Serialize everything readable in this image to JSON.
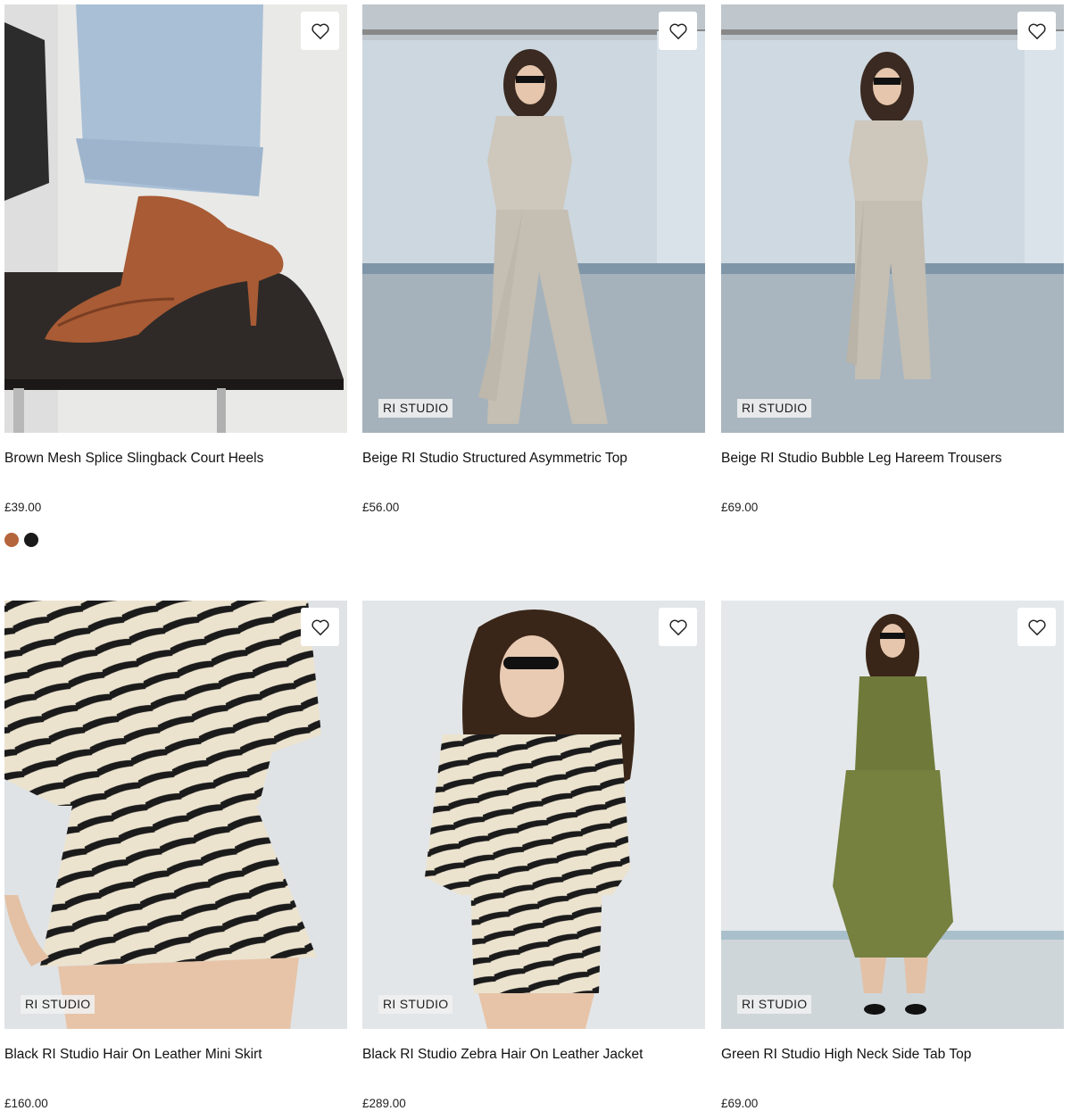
{
  "products": [
    {
      "title": "Brown Mesh Splice Slingback Court Heels",
      "price": "£39.00",
      "badge": "",
      "swatches": [
        "#b5653b",
        "#1a1a1a"
      ]
    },
    {
      "title": "Beige RI Studio Structured Asymmetric Top",
      "price": "£56.00",
      "badge": "RI STUDIO"
    },
    {
      "title": "Beige RI Studio Bubble Leg Hareem Trousers",
      "price": "£69.00",
      "badge": "RI STUDIO"
    },
    {
      "title": "Black RI Studio Hair On Leather Mini Skirt",
      "price": "£160.00",
      "badge": "RI STUDIO"
    },
    {
      "title": "Black RI Studio Zebra Hair On Leather Jacket",
      "price": "£289.00",
      "badge": "RI STUDIO"
    },
    {
      "title": "Green RI Studio High Neck Side Tab Top",
      "price": "£69.00",
      "badge": "RI STUDIO"
    }
  ],
  "icons": {
    "wishlist": "heart-outline-icon"
  }
}
